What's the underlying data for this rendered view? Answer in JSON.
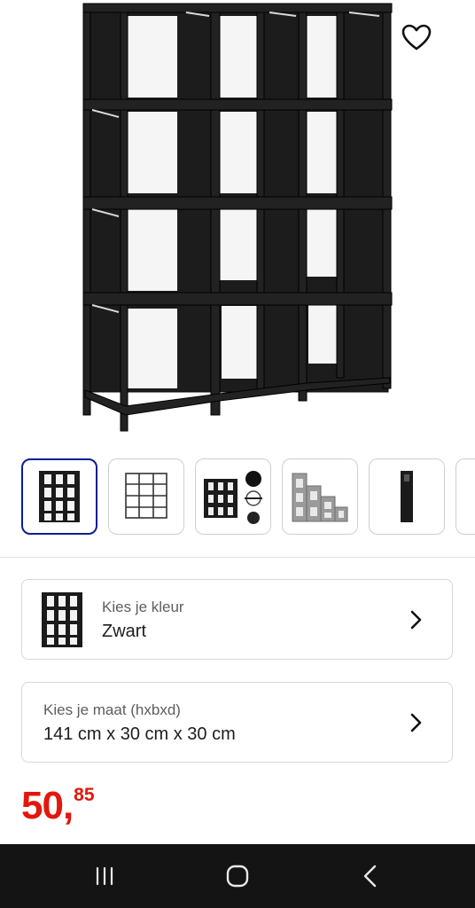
{
  "product": {
    "main_image": "cube-storage-shelf-black-4x3",
    "favorite_icon": "heart-outline-icon"
  },
  "thumbnails": [
    {
      "image": "shelf-front-black",
      "selected": true
    },
    {
      "image": "shelf-line-drawing",
      "selected": false
    },
    {
      "image": "shelf-parts-detail",
      "selected": false
    },
    {
      "image": "shelf-stair-variant",
      "selected": false
    },
    {
      "image": "shelf-single-column",
      "selected": false
    },
    {
      "image": "more-thumbnail",
      "selected": false
    }
  ],
  "color_option": {
    "label": "Kies je kleur",
    "value": "Zwart",
    "thumb_icon": "shelf-thumbnail-icon"
  },
  "size_option": {
    "label": "Kies je maat (hxbxd)",
    "value": "141 cm x 30 cm x 30 cm"
  },
  "price": {
    "whole": "50,",
    "cents": "85",
    "color": "#e3170d"
  },
  "navbar": {
    "buttons": [
      "recent-apps-icon",
      "home-icon",
      "back-icon"
    ]
  },
  "colors": {
    "accent": "#0b1f8f",
    "navbar": "#141414"
  }
}
